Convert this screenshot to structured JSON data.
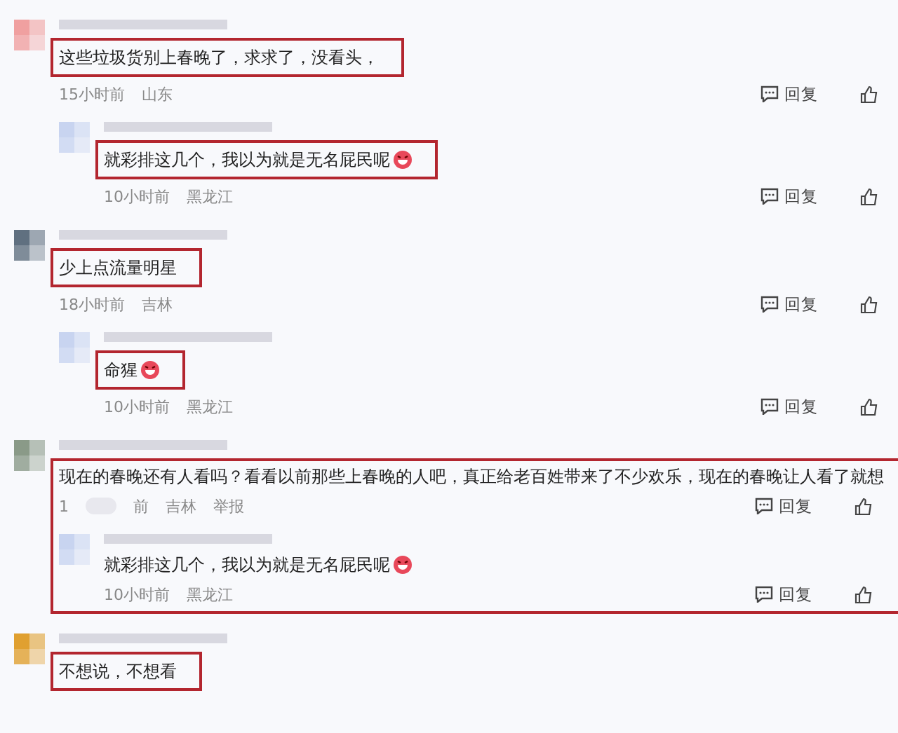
{
  "threads": [
    {
      "block_highlight": false,
      "comment": {
        "text": "这些垃圾货别上春晚了，求求了，没看头，",
        "highlighted": true,
        "meta": [
          {
            "kind": "text",
            "text": "15小时前"
          },
          {
            "kind": "text",
            "text": "山东"
          }
        ],
        "reply_label": "回复"
      },
      "replies": [
        {
          "text": "就彩排这几个，我以为就是无名屁民呢",
          "emoji": true,
          "highlighted": true,
          "meta": [
            {
              "kind": "text",
              "text": "10小时前"
            },
            {
              "kind": "text",
              "text": "黑龙江"
            }
          ],
          "reply_label": "回复"
        }
      ]
    },
    {
      "block_highlight": false,
      "comment": {
        "text": "少上点流量明星",
        "highlighted": true,
        "meta": [
          {
            "kind": "text",
            "text": "18小时前"
          },
          {
            "kind": "text",
            "text": "吉林"
          }
        ],
        "reply_label": "回复"
      },
      "replies": [
        {
          "text": "命猩",
          "emoji": true,
          "highlighted": true,
          "meta": [
            {
              "kind": "text",
              "text": "10小时前"
            },
            {
              "kind": "text",
              "text": "黑龙江"
            }
          ],
          "reply_label": "回复"
        }
      ]
    },
    {
      "block_highlight": true,
      "comment": {
        "text": "现在的春晚还有人看吗？看看以前那些上春晚的人吧，真正给老百姓带来了不少欢乐，现在的春晚让人看了就想",
        "highlighted": false,
        "meta": [
          {
            "kind": "text",
            "text": "1"
          },
          {
            "kind": "blur"
          },
          {
            "kind": "text",
            "text": "前"
          },
          {
            "kind": "text",
            "text": "吉林"
          },
          {
            "kind": "text",
            "text": "举报"
          }
        ],
        "reply_label": "回复"
      },
      "replies": [
        {
          "text": "就彩排这几个，我以为就是无名屁民呢",
          "emoji": true,
          "highlighted": false,
          "meta": [
            {
              "kind": "text",
              "text": "10小时前"
            },
            {
              "kind": "text",
              "text": "黑龙江"
            }
          ],
          "reply_label": "回复"
        }
      ]
    },
    {
      "block_highlight": false,
      "comment": {
        "text": "不想说，不想看",
        "highlighted": true
      }
    }
  ]
}
